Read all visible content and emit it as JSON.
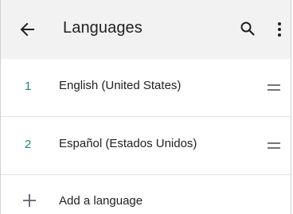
{
  "header": {
    "title": "Languages",
    "icons": [
      "arrow-back-icon",
      "search-icon",
      "more-vert-icon"
    ]
  },
  "languages": [
    {
      "index": "1",
      "label": "English (United States)"
    },
    {
      "index": "2",
      "label": "Español (Estados Unidos)"
    }
  ],
  "add_language": {
    "label": "Add a language"
  },
  "colors": {
    "accent": "#1a8a7a",
    "appbar": "#f2f2f2",
    "text": "#202124",
    "divider": "#e3e3e3"
  }
}
